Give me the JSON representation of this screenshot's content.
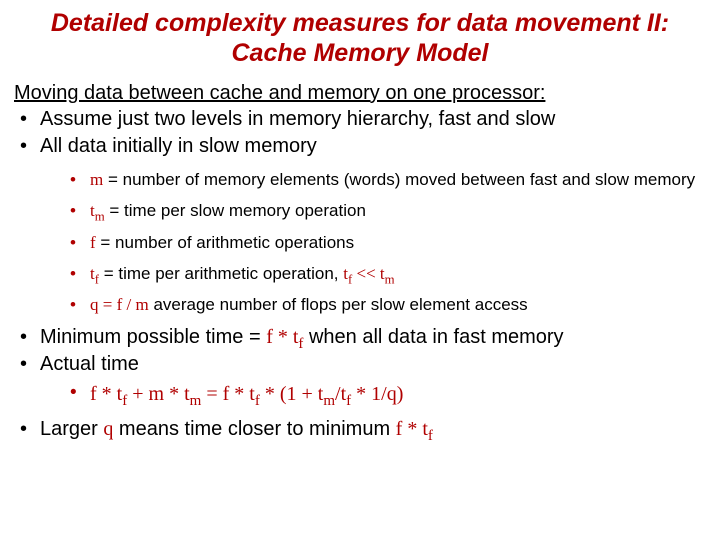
{
  "title_line1": "Detailed complexity measures for data movement II:",
  "title_line2": "Cache Memory Model",
  "section_head": "Moving data between cache and memory on one processor:",
  "b1": "Assume just two levels in memory hierarchy, fast and slow",
  "b2": "All data initially in slow memory",
  "defs": {
    "m_var": "m",
    "m_txt": " = number of memory elements (words) moved between fast and slow memory",
    "tm_t": "t",
    "tm_sub": "m",
    "tm_txt": " = time per slow memory operation",
    "f_var": "f",
    "f_txt": " = number of arithmetic operations",
    "tf_t": "t",
    "tf_sub": "f",
    "tf_txt1": " = time per arithmetic operation,  ",
    "tf_rel": " << ",
    "q_var": "q",
    "q_eq": " = ",
    "q_f": "f",
    "q_slash": " / ",
    "q_m": "m",
    "q_txt": "   average number of flops per slow element access"
  },
  "min": {
    "pre": "Minimum possible time = ",
    "expr_f": "f",
    "star": " * ",
    "expr_t": "t",
    "expr_sub": "f",
    "post": "  when all data in fast memory"
  },
  "actual": {
    "label": "Actual time",
    "lhs_f": "f",
    "star": " * ",
    "lhs_tf_t": "t",
    "lhs_tf_s": "f",
    "plus": "  +  ",
    "lhs_m": "m",
    "lhs_tm_t": "t",
    "lhs_tm_s": "m",
    "eq": "   =   ",
    "rhs_f": "f",
    "rhs_tf_t": "t",
    "rhs_tf_s": "f",
    "open": " * (1 + ",
    "rhs_tm_t": "t",
    "rhs_tm_s": "m",
    "slash": "/",
    "rhs_tf2_t": "t",
    "rhs_tf2_s": "f",
    "mid": "  * 1/",
    "rhs_q": "q",
    "close": ")"
  },
  "larger": {
    "pre": "Larger ",
    "q": "q",
    "mid": " means time closer to minimum ",
    "f": "f",
    "star": " * ",
    "t": "t",
    "sub": "f"
  }
}
